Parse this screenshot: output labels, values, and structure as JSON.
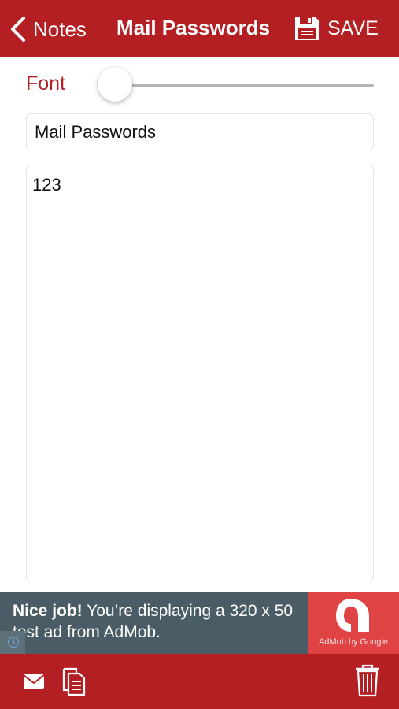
{
  "nav": {
    "back_label": "Notes",
    "title": "Mail Passwords",
    "save_label": "SAVE"
  },
  "font_control": {
    "label": "Font",
    "level": 0
  },
  "note": {
    "title_value": "Mail Passwords",
    "body_value": "123"
  },
  "ad": {
    "headline": "Nice job!",
    "message": "You’re displaying a 320 x 50 test ad from AdMob.",
    "logo_text": "AdMob by Google"
  },
  "toolbar": {
    "icons": [
      "mail-icon",
      "copy-icon",
      "trash-icon"
    ]
  },
  "colors": {
    "brand_red": "#b41f24",
    "ad_background": "#4a5d66",
    "ad_logo_red": "#e04343"
  }
}
